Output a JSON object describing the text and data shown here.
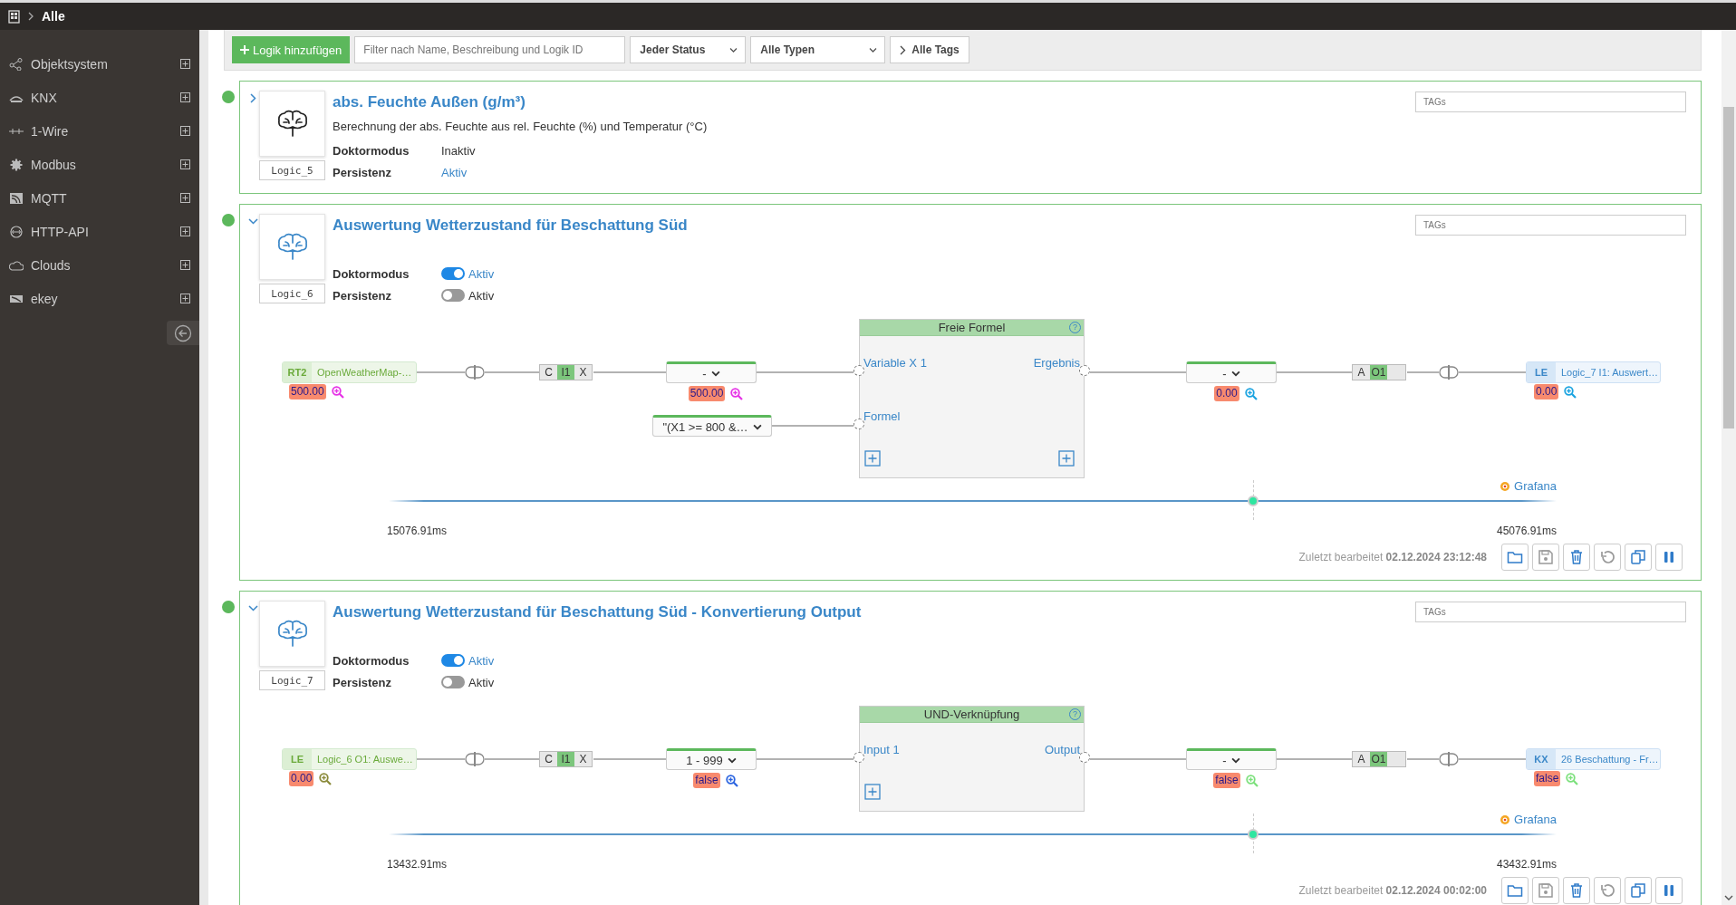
{
  "top_bar": {
    "breadcrumb": "Alle"
  },
  "sidebar": {
    "items": [
      {
        "label": "Objektsystem",
        "kind": "share"
      },
      {
        "label": "KNX",
        "kind": "knx"
      },
      {
        "label": "1-Wire",
        "kind": "wire"
      },
      {
        "label": "Modbus",
        "kind": "gear"
      },
      {
        "label": "MQTT",
        "kind": "signal"
      },
      {
        "label": "HTTP-API",
        "kind": "globe"
      },
      {
        "label": "Clouds",
        "kind": "cloud"
      },
      {
        "label": "ekey",
        "kind": "card"
      }
    ]
  },
  "toolbar": {
    "add_button": "Logik hinzufügen",
    "filter": {
      "placeholder": "Filter nach Name, Beschreibung und Logik ID"
    },
    "status_select": "Jeder Status",
    "type_select": "Alle Typen",
    "tags_button": "Alle Tags"
  },
  "logics": [
    {
      "color": "#5cb85c",
      "expanded": false,
      "id": "Logic_5",
      "title": "abs. Feuchte Außen (g/m³)",
      "description": "Berechnung der abs. Feuchte aus rel. Feuchte (%) und Temperatur (°C)",
      "properties": [
        {
          "label": "Doktormodus",
          "kind": "text",
          "value": "Inaktiv",
          "on": false
        },
        {
          "label": "Persistenz",
          "kind": "text",
          "value": "Aktiv",
          "on": true
        }
      ],
      "tags": {
        "placeholder": "TAGs"
      }
    },
    {
      "color": "#5cb85c",
      "expanded": true,
      "id": "Logic_6",
      "title": "Auswertung Wetterzustand für Beschattung Süd",
      "properties": [
        {
          "label": "Doktormodus",
          "kind": "toggle",
          "value": "Aktiv",
          "on": true
        },
        {
          "label": "Persistenz",
          "kind": "toggle",
          "value": "Aktiv",
          "on": false
        }
      ],
      "tags": {
        "placeholder": "TAGs"
      },
      "flow": {
        "inputs": [
          {
            "kind": "chain",
            "source": {
              "tag": "RT2",
              "label": "OpenWeatherMap-…",
              "value": "500.00",
              "color": "#e632e6"
            },
            "filter": [
              {
                "text": "C",
                "selected": false
              },
              {
                "text": "I1",
                "selected": true
              },
              {
                "text": "X",
                "selected": false
              }
            ],
            "select": {
              "label": "-",
              "value": "500.00",
              "color": "#e632e6"
            }
          },
          {
            "kind": "constant",
            "select": {
              "label": "\"(X1 >= 800 &…"
            }
          }
        ],
        "block": {
          "title": "Freie Formel",
          "help": "?",
          "rows": [
            {
              "input": "Variable X 1",
              "output": "Ergebnis"
            },
            {
              "input": "Formel"
            }
          ],
          "add_input": true,
          "add_output": true
        },
        "output": {
          "select": {
            "label": "-",
            "value": "0.00",
            "color": "#1aa3e0"
          },
          "filter": [
            {
              "text": "A",
              "selected": false
            },
            {
              "text": "O1",
              "selected": true
            }
          ],
          "target": {
            "tag": "LE",
            "label": "Logic_7 I1: Auswert…",
            "value": "0.00",
            "color": "#1aa3e0"
          }
        }
      },
      "timeline": {
        "start": "15076.91ms",
        "end": "45076.91ms",
        "link": "Grafana",
        "level": 0.74
      },
      "footer": {
        "edited_label": "Zuletzt bearbeitet",
        "edited_at": "02.12.2024 23:12:48",
        "buttons": [
          {
            "kind": "folder",
            "disabled": false
          },
          {
            "kind": "save",
            "disabled": true
          },
          {
            "kind": "trash",
            "disabled": false
          },
          {
            "kind": "undo",
            "disabled": true
          },
          {
            "kind": "copy",
            "disabled": false
          },
          {
            "kind": "pause",
            "disabled": false
          }
        ]
      }
    },
    {
      "color": "#5cb85c",
      "expanded": true,
      "id": "Logic_7",
      "title": "Auswertung Wetterzustand für Beschattung Süd - Konvertierung Output",
      "properties": [
        {
          "label": "Doktormodus",
          "kind": "toggle",
          "value": "Aktiv",
          "on": true
        },
        {
          "label": "Persistenz",
          "kind": "toggle",
          "value": "Aktiv",
          "on": false
        }
      ],
      "tags": {
        "placeholder": "TAGs"
      },
      "flow": {
        "inputs": [
          {
            "kind": "chain",
            "source": {
              "tag": "LE",
              "label": "Logic_6 O1: Auswe…",
              "value": "0.00",
              "color": "#8a8a3a"
            },
            "filter": [
              {
                "text": "C",
                "selected": false
              },
              {
                "text": "I1",
                "selected": true
              },
              {
                "text": "X",
                "selected": false
              }
            ],
            "select": {
              "label": "1 - 999",
              "value": "false",
              "color": "#2a63e0"
            }
          }
        ],
        "block": {
          "title": "UND-Verknüpfung",
          "help": "?",
          "rows": [
            {
              "input": "Input 1",
              "output": "Output"
            }
          ],
          "add_input": true,
          "add_output": false
        },
        "output": {
          "select": {
            "label": "-",
            "value": "false",
            "color": "#7be07b"
          },
          "filter": [
            {
              "text": "A",
              "selected": false
            },
            {
              "text": "O1",
              "selected": true
            }
          ],
          "target": {
            "tag": "KX",
            "label": "26 Beschattung - Fr…",
            "value": "false",
            "color": "#7be07b"
          }
        }
      },
      "timeline": {
        "start": "13432.91ms",
        "end": "43432.91ms",
        "link": "Grafana",
        "level": 0.74
      },
      "footer": {
        "edited_label": "Zuletzt bearbeitet",
        "edited_at": "02.12.2024 00:02:00",
        "buttons": [
          {
            "kind": "folder",
            "disabled": false
          },
          {
            "kind": "save",
            "disabled": true
          },
          {
            "kind": "trash",
            "disabled": false
          },
          {
            "kind": "undo",
            "disabled": true
          },
          {
            "kind": "copy",
            "disabled": false
          },
          {
            "kind": "pause",
            "disabled": false
          }
        ]
      }
    }
  ]
}
